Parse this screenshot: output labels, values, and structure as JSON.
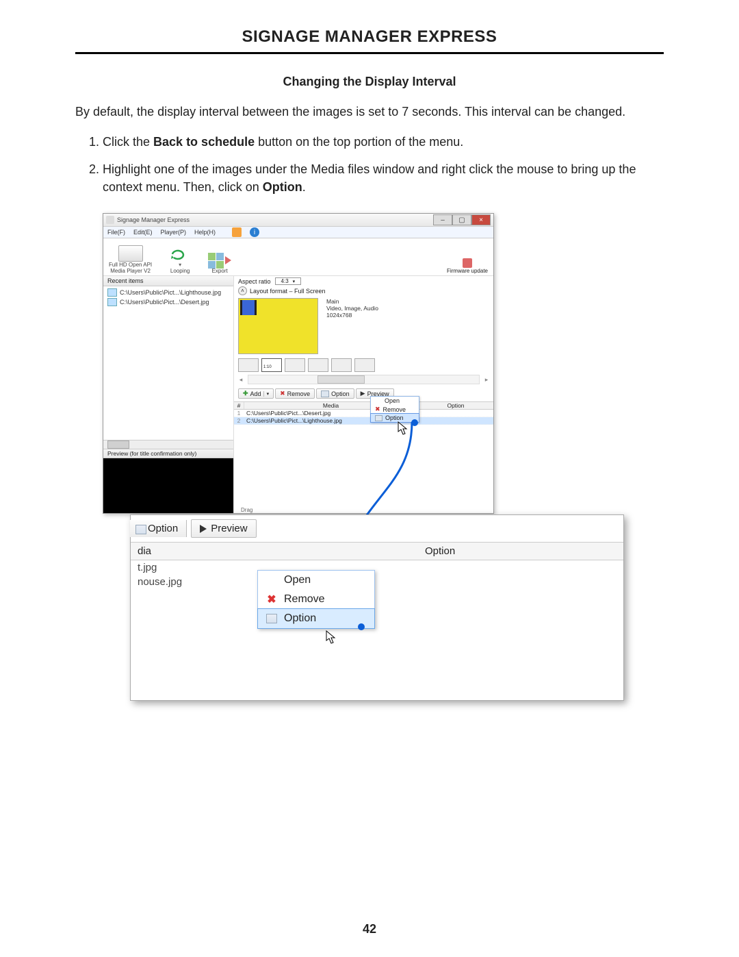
{
  "header": "SIGNAGE MANAGER EXPRESS",
  "section_title": "Changing the Display Interval",
  "intro": "By default, the display interval between the images is set to 7 seconds.  This interval can be changed.",
  "steps": {
    "s1_a": "Click the ",
    "s1_bold": "Back to schedule",
    "s1_b": " button on the top portion of the menu.",
    "s2_a": "Highlight one of the images under the Media files window and right click the mouse to bring up the context menu.  Then, click on ",
    "s2_bold": "Option",
    "s2_b": "."
  },
  "page_number": "42",
  "app": {
    "title": "Signage Manager Express",
    "menus": {
      "file": "File(F)",
      "edit": "Edit(E)",
      "player": "Player(P)",
      "help": "Help(H)"
    },
    "toolbar": {
      "player_line1": "Full HD Open API",
      "player_line2": "Media Player V2",
      "looping": "Looping",
      "export": "Export",
      "firmware": "Firmware update"
    },
    "left": {
      "recent": "Recent items",
      "item1": "C:\\Users\\Public\\Pict...\\Lighthouse.jpg",
      "item2": "C:\\Users\\Public\\Pict...\\Desert.jpg",
      "preview_hdr": "Preview (for title confirmation only)",
      "drag": "Drag"
    },
    "right": {
      "aspect_label": "Aspect ratio",
      "aspect_value": "4:3",
      "layout_label": "Layout format – Full Screen",
      "main_label": "Main",
      "main_types": "Video, Image, Audio",
      "main_res": "1024x768",
      "layout_code": "1:10",
      "btn_add": "Add",
      "btn_remove": "Remove",
      "btn_option": "Option",
      "btn_preview": "Preview",
      "col_num": "#",
      "col_media": "Media",
      "col_option": "Option",
      "row1_media": "C:\\Users\\Public\\Pict...\\Desert.jpg",
      "row2_media": "C:\\Users\\Public\\Pict...\\Lighthouse.jpg"
    },
    "ctx_small": {
      "open": "Open",
      "remove": "Remove",
      "option": "Option"
    }
  },
  "zoom": {
    "option_btn": "Option",
    "preview_btn": "Preview",
    "hdr_media_frag": "dia",
    "hdr_option": "Option",
    "row1": "t.jpg",
    "row2": "nouse.jpg",
    "ctx": {
      "open": "Open",
      "remove": "Remove",
      "option": "Option"
    }
  }
}
